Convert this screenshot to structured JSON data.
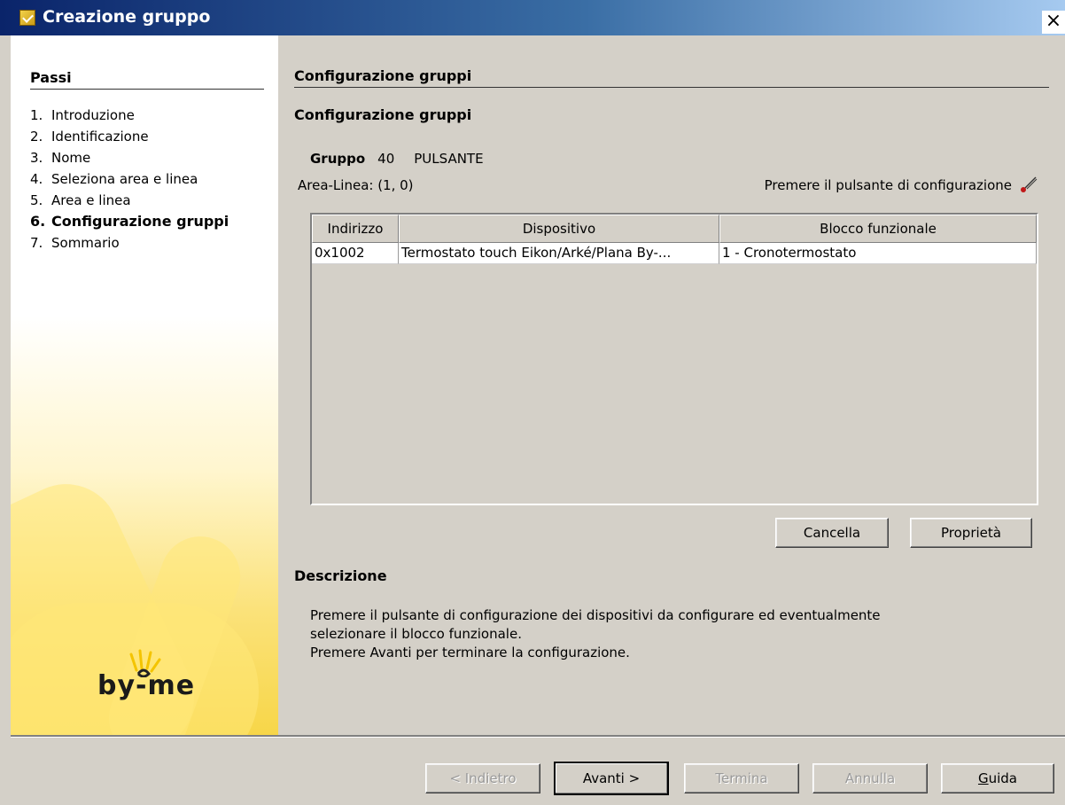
{
  "window": {
    "title": "Creazione gruppo",
    "close_label": "×"
  },
  "sidebar": {
    "title": "Passi",
    "steps": [
      {
        "num": "1.",
        "label": "Introduzione"
      },
      {
        "num": "2.",
        "label": "Identificazione"
      },
      {
        "num": "3.",
        "label": "Nome"
      },
      {
        "num": "4.",
        "label": "Seleziona area e linea"
      },
      {
        "num": "5.",
        "label": "Area e linea"
      },
      {
        "num": "6.",
        "label": "Configurazione gruppi"
      },
      {
        "num": "7.",
        "label": "Sommario"
      }
    ],
    "active_step": 6,
    "logo_text": "by-me"
  },
  "main": {
    "title": "Configurazione gruppi",
    "subtitle": "Configurazione gruppi",
    "group_label": "Gruppo",
    "group_number": "40",
    "group_name": "PULSANTE",
    "area_line": "Area-Linea: (1, 0)",
    "press_hint": "Premere il pulsante di configurazione"
  },
  "table": {
    "columns": [
      "Indirizzo",
      "Dispositivo",
      "Blocco funzionale"
    ],
    "rows": [
      [
        "0x1002",
        "Termostato touch Eikon/Arké/Plana By-...",
        "1 - Cronotermostato"
      ]
    ]
  },
  "table_buttons": {
    "delete": "Cancella",
    "properties": "Proprietà"
  },
  "description": {
    "title": "Descrizione",
    "line1": "Premere il pulsante di configurazione dei dispositivi da configurare ed eventualmente",
    "line2": "selezionare il blocco funzionale.",
    "line3": "Premere Avanti per terminare la configurazione."
  },
  "footer": {
    "back": "< Indietro",
    "next": "Avanti >",
    "finish": "Termina",
    "cancel": "Annulla",
    "help": "Guida"
  },
  "colors": {
    "titlebar": "#0a246a",
    "dialog_bg": "#d4d0c8",
    "sidebar_yellow": "#f7d648"
  }
}
